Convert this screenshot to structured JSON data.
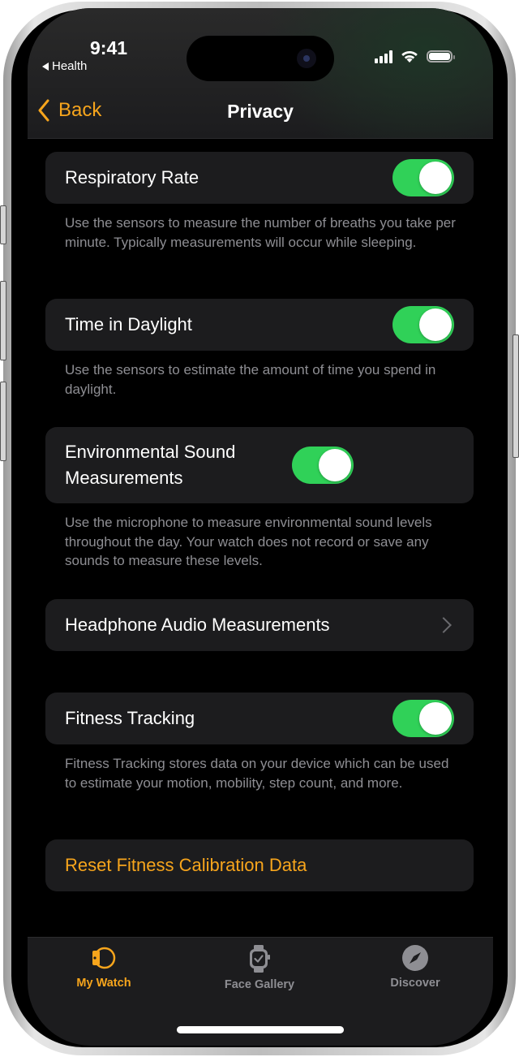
{
  "status_bar": {
    "time": "9:41",
    "back_app": "Health"
  },
  "nav": {
    "back_label": "Back",
    "title": "Privacy"
  },
  "settings": [
    {
      "label": "Respiratory Rate",
      "control": "toggle",
      "enabled": true,
      "footer": "Use the sensors to measure the number of breaths you take per minute. Typically measurements will occur while sleeping."
    },
    {
      "label": "Time in Daylight",
      "control": "toggle",
      "enabled": true,
      "footer": "Use the sensors to estimate the amount of time you spend in daylight."
    },
    {
      "label": "Environmental Sound Measurements",
      "control": "toggle",
      "enabled": true,
      "footer": "Use the microphone to measure environmental sound levels throughout the day. Your watch does not record or save any sounds to measure these levels."
    },
    {
      "label": "Headphone Audio Measurements",
      "control": "disclosure"
    },
    {
      "label": "Fitness Tracking",
      "control": "toggle",
      "enabled": true,
      "footer": "Fitness Tracking stores data on your device which can be used to estimate your motion, mobility, step count, and more."
    },
    {
      "label": "Reset Fitness Calibration Data",
      "control": "action"
    }
  ],
  "tabbar": {
    "items": [
      {
        "label": "My Watch",
        "icon": "watch-side-icon",
        "active": true
      },
      {
        "label": "Face Gallery",
        "icon": "watch-face-icon",
        "active": false
      },
      {
        "label": "Discover",
        "icon": "compass-icon",
        "active": false
      }
    ]
  },
  "colors": {
    "accent": "#f7a51c",
    "toggle_on": "#30d158",
    "cell_bg": "#1c1c1e",
    "footer_text": "#8e8e93"
  }
}
